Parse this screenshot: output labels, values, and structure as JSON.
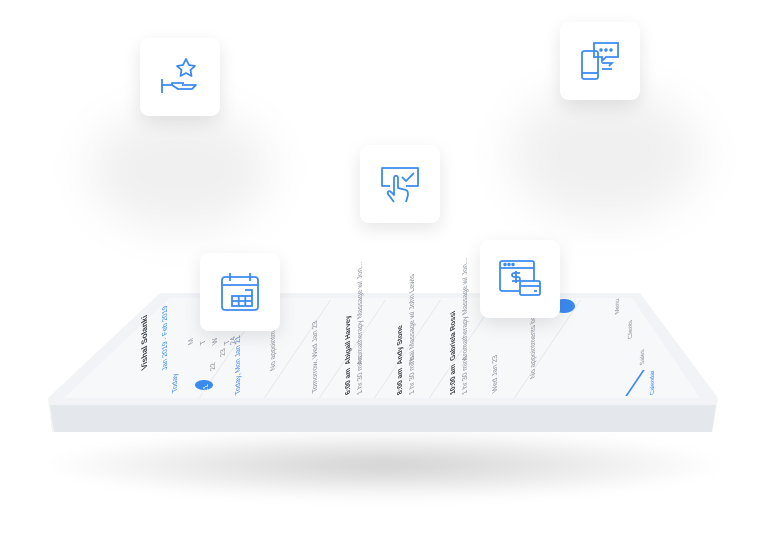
{
  "accent_color": "#3b8af0",
  "icons": [
    "hand-star-icon",
    "phone-chat-icon",
    "touch-check-icon",
    "calendar-grid-icon",
    "browser-payment-icon"
  ],
  "phone": {
    "profile": {
      "name": "Vishal Solanki",
      "date_range": "Jan 2019 - Feb 2019",
      "today_label": "Today"
    },
    "mini_calendar": {
      "days": [
        "M",
        "T",
        "W",
        "T"
      ],
      "dates": [
        "21",
        "22",
        "23",
        "24"
      ],
      "selected": "21"
    },
    "day_columns": [
      {
        "header": "Today, Mon Jan 21",
        "empty": "No appointments booked"
      },
      {
        "header": "Tomorrow, Wed Jan 23",
        "appointments": [
          {
            "time": "6:00 am",
            "client": "Abigail Harvey",
            "duration": "1 hr 30 mins",
            "service": "Aromatherapy Massage w/ Jon..."
          },
          {
            "time": "8:00 am",
            "client": "Andy Stone",
            "duration": "1 hr 30 mins",
            "service": "Thai Massage w/ John Lewis"
          },
          {
            "time": "10:00 am",
            "client": "Gabriela Rossi",
            "duration": "1 hr 30 mins",
            "service": "Aromatherapy Massage w/ Jon..."
          }
        ]
      },
      {
        "header": "Wed Jan 23",
        "empty": "No appointments booked"
      }
    ],
    "nav": [
      "Calendar",
      "Sales",
      "Clients",
      "Menu"
    ]
  }
}
